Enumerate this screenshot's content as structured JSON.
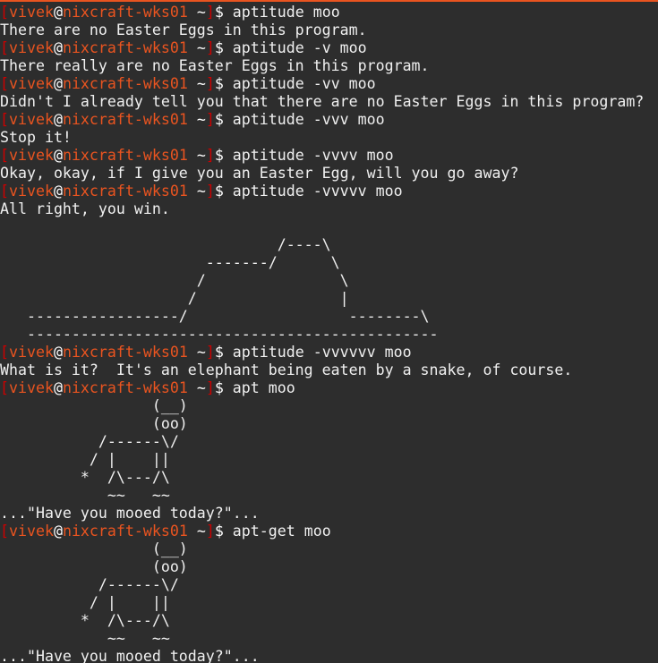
{
  "window": {
    "accent_color": "#e95420",
    "background_color": "#2d2d2d",
    "text_color": "#f0f0f0"
  },
  "prompt": {
    "bracket_open": "[",
    "user": "vivek",
    "at": "@",
    "host": "nixcraft-wks01",
    "cwd": " ~",
    "bracket_close": "]",
    "symbol": "$ ",
    "bracket_color": "#cc0000",
    "user_color": "#e95420"
  },
  "lines": [
    {
      "type": "prompt",
      "command": "aptitude moo"
    },
    {
      "type": "output",
      "text": "There are no Easter Eggs in this program."
    },
    {
      "type": "prompt",
      "command": "aptitude -v moo"
    },
    {
      "type": "output",
      "text": "There really are no Easter Eggs in this program."
    },
    {
      "type": "prompt",
      "command": "aptitude -vv moo"
    },
    {
      "type": "output",
      "text": "Didn't I already tell you that there are no Easter Eggs in this program?"
    },
    {
      "type": "prompt",
      "command": "aptitude -vvv moo"
    },
    {
      "type": "output",
      "text": "Stop it!"
    },
    {
      "type": "prompt",
      "command": "aptitude -vvvv moo"
    },
    {
      "type": "output",
      "text": "Okay, okay, if I give you an Easter Egg, will you go away?"
    },
    {
      "type": "prompt",
      "command": "aptitude -vvvvv moo"
    },
    {
      "type": "output",
      "text": "All right, you win."
    },
    {
      "type": "output",
      "text": ""
    },
    {
      "type": "output",
      "text": "                               /----\\"
    },
    {
      "type": "output",
      "text": "                       -------/      \\"
    },
    {
      "type": "output",
      "text": "                      /               \\"
    },
    {
      "type": "output",
      "text": "                     /                |"
    },
    {
      "type": "output",
      "text": "   -----------------/                  --------\\"
    },
    {
      "type": "output",
      "text": "   ----------------------------------------------"
    },
    {
      "type": "prompt",
      "command": "aptitude -vvvvvv moo"
    },
    {
      "type": "output",
      "text": "What is it?  It's an elephant being eaten by a snake, of course."
    },
    {
      "type": "prompt",
      "command": "apt moo"
    },
    {
      "type": "output",
      "text": "                 (__)"
    },
    {
      "type": "output",
      "text": "                 (oo)"
    },
    {
      "type": "output",
      "text": "           /------\\/"
    },
    {
      "type": "output",
      "text": "          / |    ||"
    },
    {
      "type": "output",
      "text": "         *  /\\---/\\"
    },
    {
      "type": "output",
      "text": "            ~~   ~~"
    },
    {
      "type": "output",
      "text": "...\"Have you mooed today?\"..."
    },
    {
      "type": "prompt",
      "command": "apt-get moo"
    },
    {
      "type": "output",
      "text": "                 (__)"
    },
    {
      "type": "output",
      "text": "                 (oo)"
    },
    {
      "type": "output",
      "text": "           /------\\/"
    },
    {
      "type": "output",
      "text": "          / |    ||"
    },
    {
      "type": "output",
      "text": "         *  /\\---/\\"
    },
    {
      "type": "output",
      "text": "            ~~   ~~"
    },
    {
      "type": "output",
      "text": "...\"Have you mooed today?\"..."
    }
  ]
}
